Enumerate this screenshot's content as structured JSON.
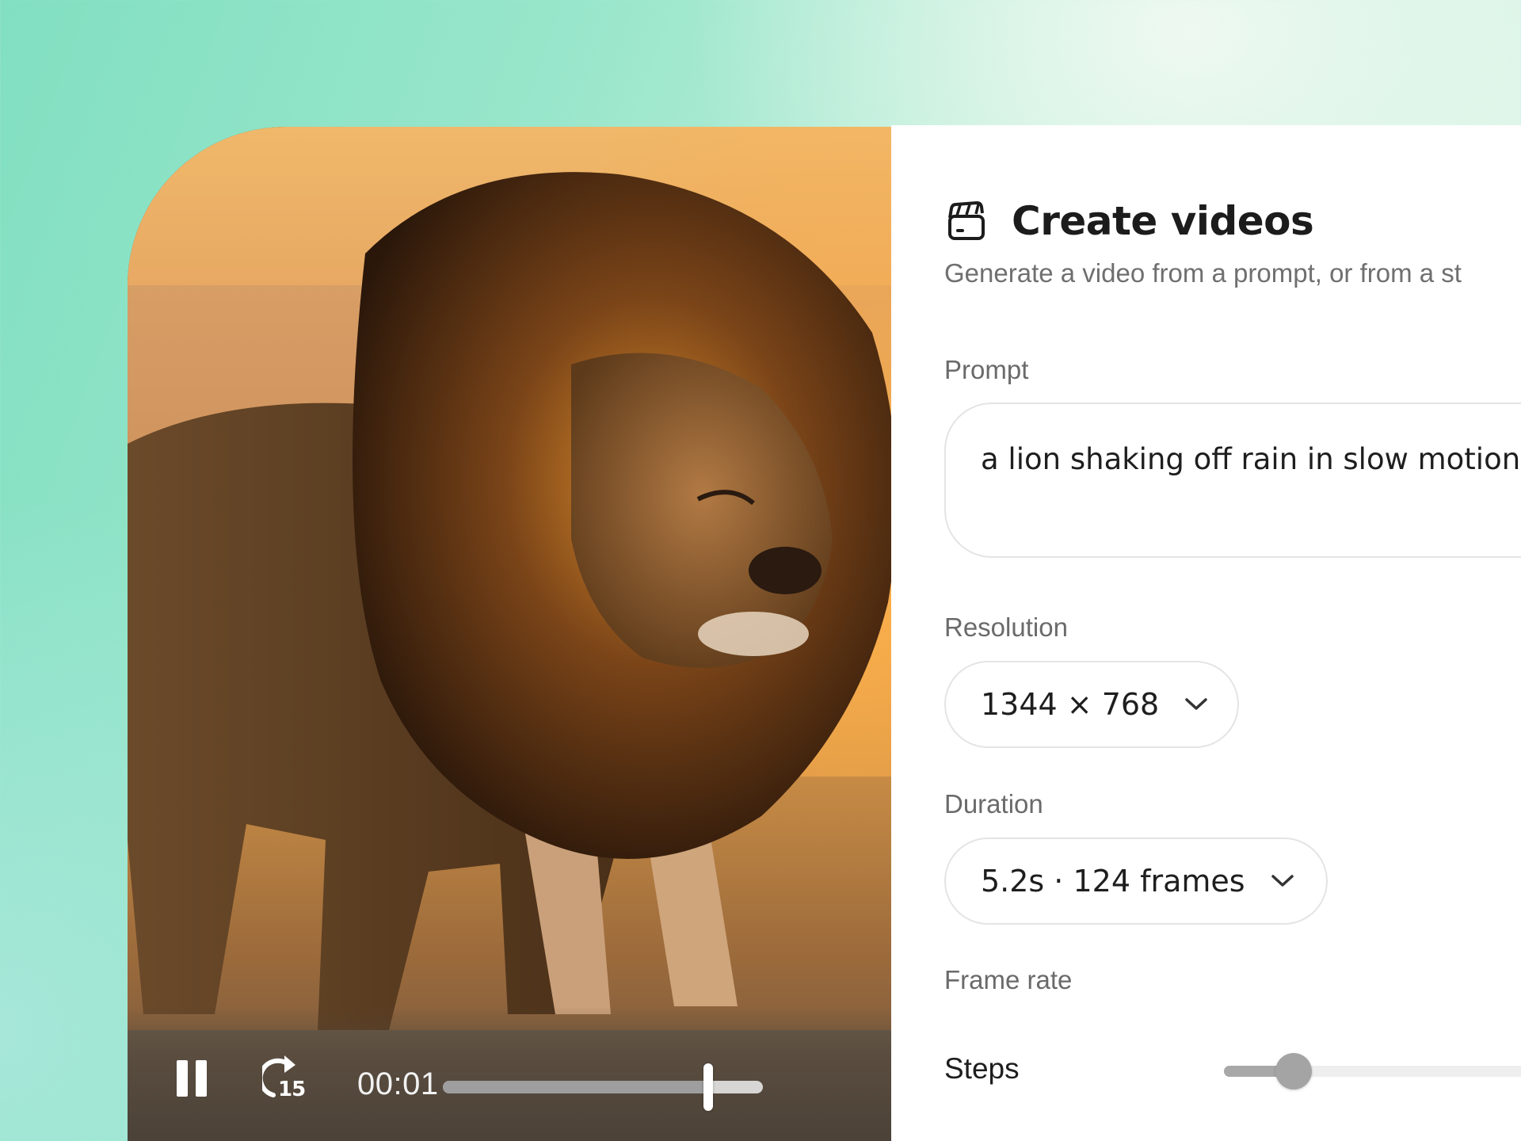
{
  "player": {
    "elapsed": "00:01",
    "skip_seconds": "15",
    "progress": 0.83
  },
  "panel": {
    "title": "Create videos",
    "subtitle": "Generate a video from a prompt, or from a st",
    "prompt_label": "Prompt",
    "prompt_value": "a lion shaking off rain in slow motion",
    "resolution_label": "Resolution",
    "resolution_value": "1344 × 768",
    "duration_label": "Duration",
    "duration_value": "5.2s · 124 frames",
    "frame_rate_label": "Frame rate",
    "steps_label": "Steps",
    "steps_level": 0.21
  },
  "icons": {
    "title_icon": "clapperboard-icon",
    "play_state": "pause-icon",
    "skip": "forward-15-icon",
    "dropdown": "chevron-down-icon"
  },
  "colors": {
    "background_green": "#82dfc1",
    "panel_bg": "#ffffff",
    "text_primary": "#1c1c1c",
    "text_secondary": "#6a6a6a"
  }
}
